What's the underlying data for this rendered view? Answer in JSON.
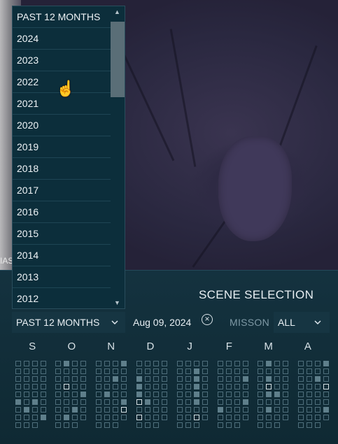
{
  "imagery": {
    "clip_label": "IAS"
  },
  "panel": {
    "title": "SCENE SELECTION",
    "range_select_value": "PAST 12 MONTHS",
    "date": "Aug 09, 2024",
    "mission_label": "MISSON",
    "mission_value": "ALL",
    "months": [
      "S",
      "O",
      "N",
      "D",
      "J",
      "F",
      "M",
      "A"
    ]
  },
  "dropdown": {
    "options": [
      "PAST 12 MONTHS",
      "2024",
      "2023",
      "2022",
      "2021",
      "2020",
      "2019",
      "2018",
      "2017",
      "2016",
      "2015",
      "2014",
      "2013",
      "2012"
    ],
    "hovered": "2022"
  },
  "calendar": {
    "months": [
      {
        "filled": [
          [
            5,
            0
          ],
          [
            5,
            2
          ],
          [
            5,
            4
          ],
          [
            5,
            5
          ],
          [
            7,
            3
          ],
          [
            6,
            1
          ]
        ],
        "selected": []
      },
      {
        "filled": [
          [
            0,
            1
          ],
          [
            6,
            2
          ],
          [
            4,
            3
          ],
          [
            6,
            4
          ],
          [
            7,
            1
          ]
        ],
        "selected": [
          [
            3,
            1
          ]
        ]
      },
      {
        "filled": [
          [
            0,
            3
          ],
          [
            2,
            2
          ],
          [
            4,
            1
          ],
          [
            5,
            3
          ]
        ],
        "selected": [
          [
            6,
            3
          ]
        ]
      },
      {
        "filled": [
          [
            2,
            0
          ],
          [
            3,
            0
          ],
          [
            5,
            1
          ],
          [
            4,
            0
          ]
        ],
        "selected": [
          [
            5,
            0
          ],
          [
            7,
            0
          ]
        ]
      },
      {
        "filled": [
          [
            1,
            2
          ],
          [
            2,
            2
          ],
          [
            3,
            2
          ],
          [
            4,
            2
          ],
          [
            5,
            2
          ]
        ],
        "selected": [
          [
            7,
            2
          ]
        ]
      },
      {
        "filled": [
          [
            2,
            3
          ],
          [
            5,
            3
          ],
          [
            6,
            0
          ]
        ],
        "selected": []
      },
      {
        "filled": [
          [
            0,
            1
          ],
          [
            2,
            1
          ],
          [
            4,
            1
          ],
          [
            4,
            2
          ],
          [
            6,
            1
          ]
        ],
        "selected": [
          [
            3,
            1
          ]
        ]
      },
      {
        "filled": [
          [
            0,
            3
          ],
          [
            2,
            2
          ],
          [
            6,
            3
          ]
        ],
        "selected": [
          [
            3,
            3
          ]
        ]
      }
    ]
  }
}
